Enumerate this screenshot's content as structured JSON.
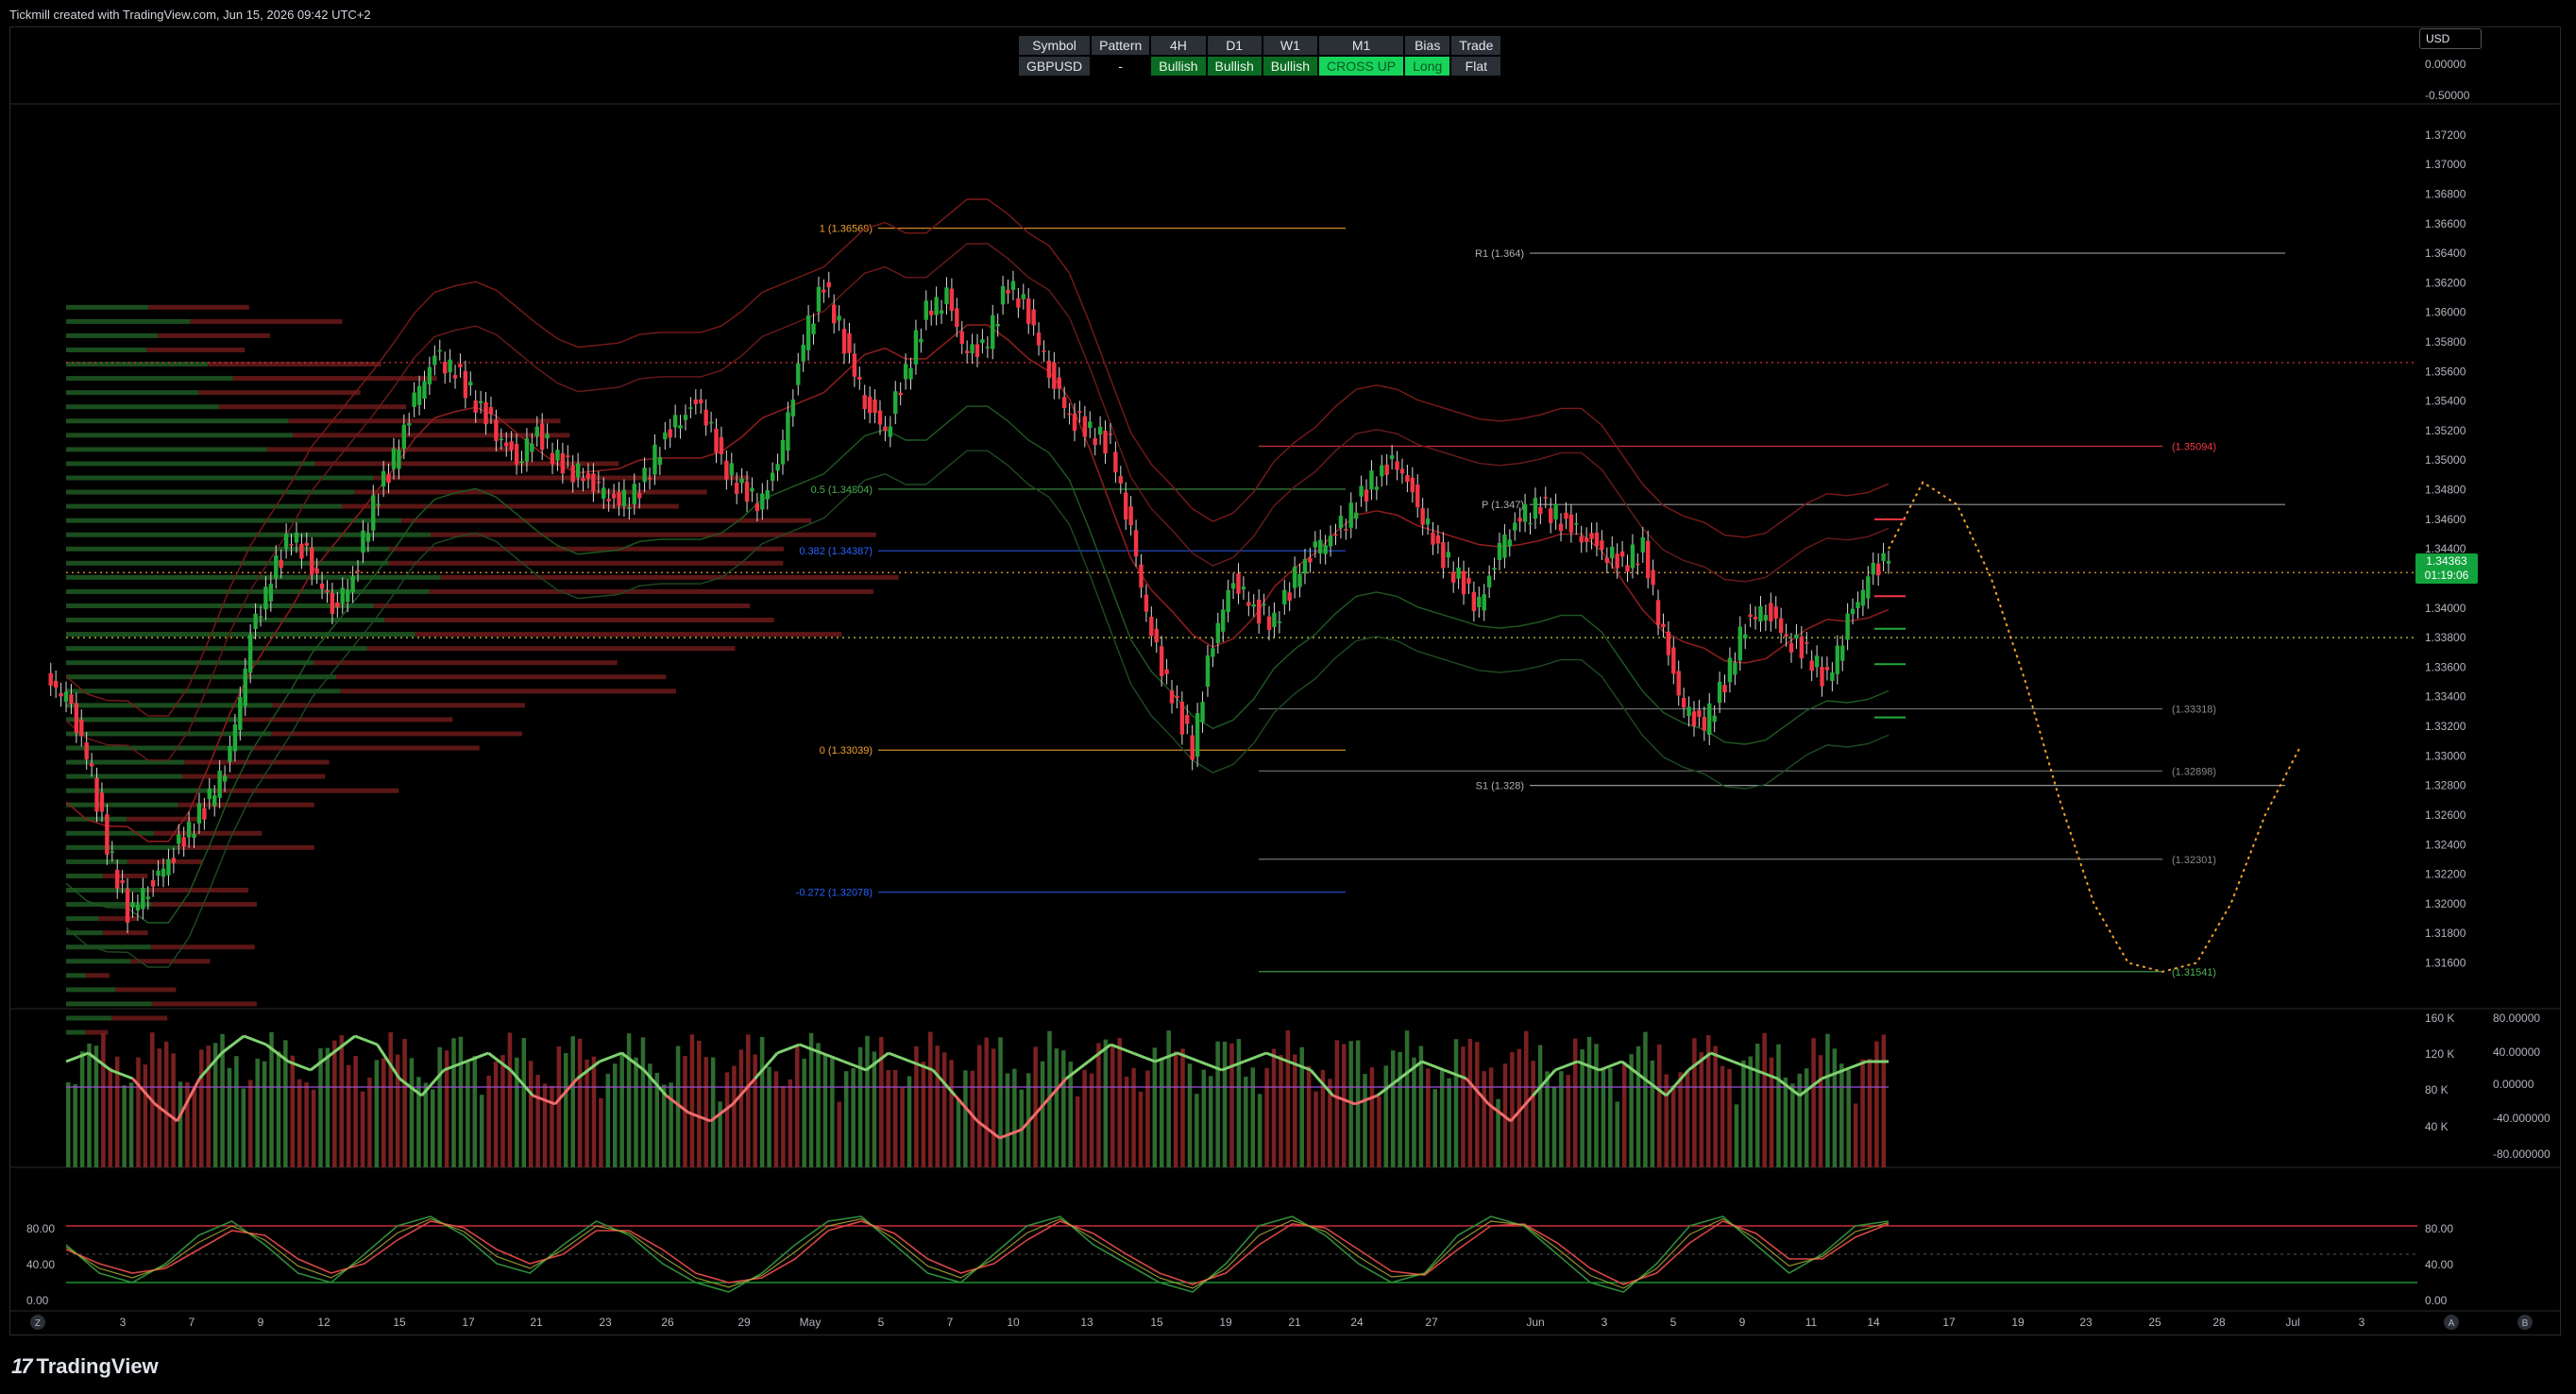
{
  "header": {
    "title": "Tickmill created with TradingView.com, Jun 15, 2026 09:42 UTC+2"
  },
  "currency": "USD",
  "status_table": {
    "headers": [
      "Symbol",
      "Pattern",
      "4H",
      "D1",
      "W1",
      "M1",
      "Bias",
      "Trade"
    ],
    "row": [
      "GBPUSD",
      "-",
      "Bullish",
      "Bullish",
      "Bullish",
      "CROSS UP",
      "Long",
      "Flat"
    ]
  },
  "price_tag": {
    "price": "1.34363",
    "countdown": "01:19:06"
  },
  "chart_data": [
    {
      "type": "line",
      "name": "main-price",
      "ylim": [
        1.3145,
        1.3725
      ],
      "x_ticks": [
        "3",
        "7",
        "9",
        "12",
        "15",
        "17",
        "21",
        "23",
        "26",
        "29",
        "May",
        "5",
        "7",
        "10",
        "13",
        "15",
        "19",
        "21",
        "24",
        "27",
        "Jun",
        "3",
        "5",
        "9",
        "11",
        "14",
        "17",
        "19",
        "23",
        "25",
        "28",
        "Jul",
        "3"
      ],
      "y_ticks": [
        "1.37200",
        "1.37000",
        "1.36800",
        "1.36600",
        "1.36400",
        "1.36200",
        "1.36000",
        "1.35800",
        "1.35600",
        "1.35400",
        "1.35200",
        "1.35000",
        "1.34800",
        "1.34600",
        "1.34400",
        "1.34200",
        "1.34000",
        "1.33800",
        "1.33600",
        "1.33400",
        "1.33200",
        "1.33000",
        "1.32800",
        "1.32600",
        "1.32400",
        "1.32200",
        "1.32000",
        "1.31800",
        "1.31600"
      ],
      "close_path": [
        1.334,
        1.33,
        1.324,
        1.3195,
        1.321,
        1.323,
        1.325,
        1.327,
        1.33,
        1.338,
        1.342,
        1.345,
        1.343,
        1.34,
        1.342,
        1.347,
        1.35,
        1.354,
        1.357,
        1.356,
        1.354,
        1.352,
        1.35,
        1.352,
        1.35,
        1.349,
        1.348,
        1.347,
        1.348,
        1.351,
        1.353,
        1.354,
        1.35,
        1.348,
        1.347,
        1.351,
        1.358,
        1.362,
        1.358,
        1.354,
        1.352,
        1.356,
        1.36,
        1.361,
        1.357,
        1.358,
        1.362,
        1.36,
        1.356,
        1.353,
        1.352,
        1.351,
        1.345,
        1.338,
        1.334,
        1.3305,
        1.338,
        1.342,
        1.34,
        1.339,
        1.342,
        1.344,
        1.345,
        1.347,
        1.349,
        1.35,
        1.347,
        1.344,
        1.342,
        1.34,
        1.344,
        1.346,
        1.347,
        1.346,
        1.345,
        1.344,
        1.343,
        1.344,
        1.338,
        1.333,
        1.332,
        1.335,
        1.339,
        1.34,
        1.338,
        1.337,
        1.335,
        1.339,
        1.342,
        1.3436
      ],
      "projection": [
        1.344,
        1.3485,
        1.347,
        1.342,
        1.335,
        1.327,
        1.32,
        1.316,
        1.3154,
        1.316,
        1.32,
        1.326,
        1.3305
      ],
      "levels": [
        {
          "label": "1 (1.36569)",
          "price": 1.36569,
          "color": "#f0a030"
        },
        {
          "label": "0 (1.33039)",
          "price": 1.33039,
          "color": "#f0a030"
        },
        {
          "label": "-0.272 (1.32078)",
          "price": 1.32078,
          "color": "#2962ff"
        },
        {
          "label": "0.382 (1.34387)",
          "price": 1.34387,
          "color": "#2962ff"
        },
        {
          "label": "0.5 (1.34804)",
          "price": 1.34804,
          "color": "#4caf50"
        },
        {
          "label": "R1 (1.364)",
          "price": 1.364,
          "color": "#b0b0b0"
        },
        {
          "label": "P (1.347)",
          "price": 1.347,
          "color": "#b0b0b0"
        },
        {
          "label": "S1 (1.328)",
          "price": 1.328,
          "color": "#b0b0b0"
        },
        {
          "label": "(1.35094)",
          "price": 1.35094,
          "color": "#f23645"
        },
        {
          "label": "(1.33318)",
          "price": 1.33318,
          "color": "#888888"
        },
        {
          "label": "(1.32898)",
          "price": 1.32898,
          "color": "#888888"
        },
        {
          "label": "(1.32301)",
          "price": 1.32301,
          "color": "#888888"
        },
        {
          "label": "(1.31541)",
          "price": 1.31541,
          "color": "#4caf50"
        }
      ],
      "top_pane_ticks": [
        "0.00000",
        "-0.50000"
      ]
    },
    {
      "type": "bar",
      "name": "volume-oscillator",
      "left_ticks": [
        "160 K",
        "120 K",
        "80 K",
        "40 K"
      ],
      "right_ticks": [
        "80.00000",
        "40.00000",
        "0.00000",
        "-40.000000",
        "-80.000000"
      ],
      "oscillator": [
        30,
        40,
        20,
        10,
        -20,
        -40,
        10,
        40,
        60,
        50,
        30,
        20,
        40,
        60,
        50,
        10,
        -10,
        20,
        30,
        40,
        20,
        -10,
        -20,
        10,
        30,
        40,
        20,
        -10,
        -30,
        -40,
        -20,
        10,
        40,
        50,
        40,
        30,
        20,
        40,
        30,
        20,
        -10,
        -40,
        -60,
        -50,
        -20,
        10,
        30,
        50,
        40,
        30,
        40,
        30,
        20,
        30,
        40,
        30,
        20,
        -10,
        -20,
        -10,
        10,
        30,
        20,
        10,
        -20,
        -40,
        -10,
        20,
        30,
        20,
        30,
        10,
        -10,
        20,
        40,
        30,
        20,
        10,
        -10,
        10,
        20,
        30,
        30
      ]
    },
    {
      "type": "line",
      "name": "stochastic",
      "ylim": [
        0,
        100
      ],
      "left_ticks": [
        "80.00",
        "40.00",
        "0.00"
      ],
      "right_ticks": [
        "80.00",
        "40.00",
        "0.00"
      ],
      "k": [
        60,
        30,
        20,
        40,
        70,
        85,
        60,
        30,
        20,
        50,
        80,
        90,
        70,
        40,
        30,
        60,
        85,
        70,
        40,
        20,
        10,
        30,
        60,
        85,
        90,
        60,
        30,
        20,
        50,
        80,
        90,
        60,
        40,
        20,
        10,
        40,
        80,
        90,
        70,
        40,
        20,
        30,
        70,
        90,
        80,
        50,
        20,
        10,
        40,
        80,
        90,
        60,
        30,
        50,
        80,
        85
      ],
      "d": [
        55,
        40,
        30,
        35,
        55,
        75,
        70,
        45,
        30,
        40,
        65,
        85,
        78,
        55,
        40,
        50,
        75,
        75,
        55,
        30,
        20,
        25,
        45,
        75,
        85,
        72,
        45,
        30,
        40,
        65,
        85,
        72,
        50,
        30,
        18,
        30,
        60,
        82,
        78,
        55,
        32,
        28,
        55,
        80,
        82,
        62,
        35,
        18,
        30,
        62,
        85,
        72,
        45,
        45,
        68,
        82
      ]
    }
  ],
  "time_axis_extra": [
    "Z",
    "A",
    "B"
  ],
  "logo": "TradingView"
}
